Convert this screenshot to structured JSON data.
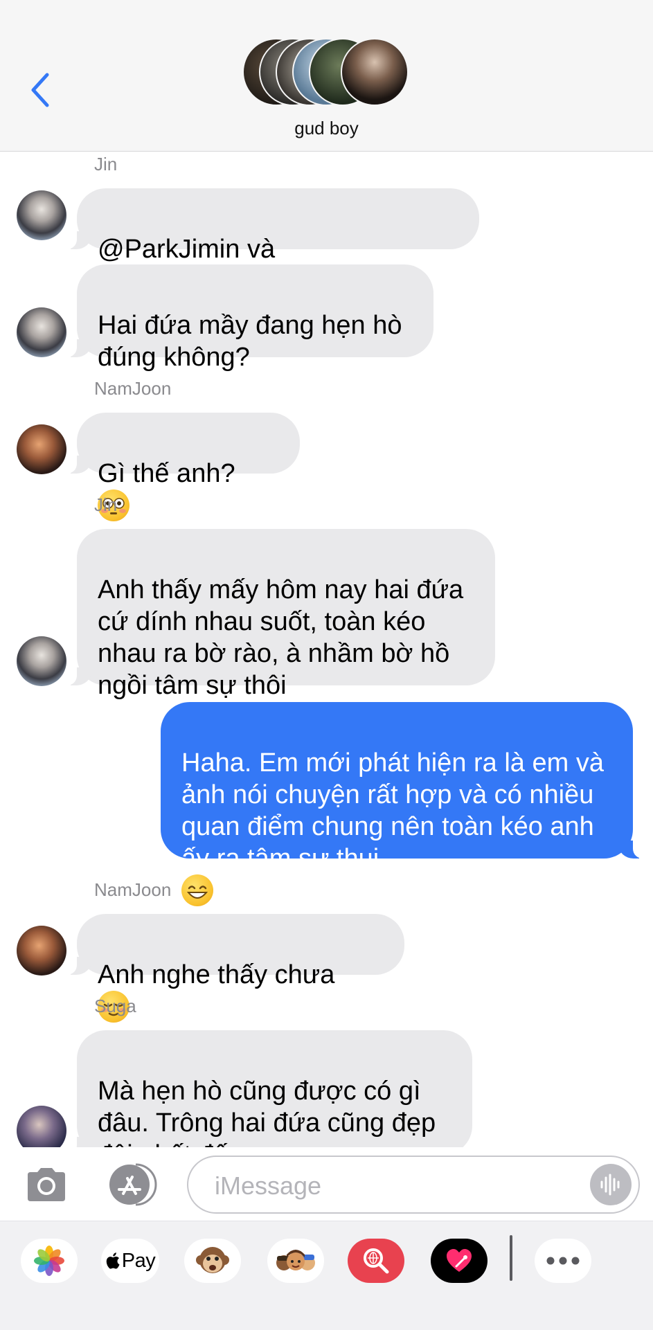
{
  "header": {
    "back_icon": "chevron-left-icon",
    "group_name": "gud boy",
    "member_avatars": [
      "member-avatar-1",
      "member-avatar-2",
      "member-avatar-3",
      "member-avatar-4",
      "member-avatar-5",
      "member-avatar-6"
    ]
  },
  "conversation": {
    "sender_jin_1": "Jin",
    "msg_jin_1": "@ParkJimin và @KimNamjoon",
    "msg_jin_2": "Hai đứa mầy đang hẹn hò\nđúng không?",
    "sender_namjoon_1": "NamJoon",
    "msg_namjoon_1": "Gì thế anh?",
    "sender_jin_2": "Jin",
    "msg_jin_3": "Anh thấy mấy hôm nay hai đứa\ncứ dính nhau suốt, toàn kéo\nnhau ra bờ rào, à nhầm bờ hồ\nngồi tâm sự thôi",
    "msg_me_1": "Haha. Em mới phát hiện ra là em và\nảnh nói chuyện rất hợp và có nhiều\nquan điểm chung nên toàn kéo anh\nấy ra tâm sự thui",
    "sender_namjoon_2": "NamJoon",
    "msg_namjoon_2": "Anh nghe thấy chưa",
    "sender_suga_1": "Suga",
    "msg_suga_1": "Mà hẹn hò cũng được có gì\nđâu. Trông hai đứa cũng đẹp\nđôi phết đấy"
  },
  "input_bar": {
    "camera_icon": "camera-icon",
    "apps_icon": "app-store-icon",
    "placeholder": "iMessage",
    "voice_icon": "audio-waveform-icon"
  },
  "app_drawer": {
    "photos": "photos-app-icon",
    "apple_pay_label": "Pay",
    "animoji": "animoji-monkey-icon",
    "memoji": "memoji-stickers-icon",
    "images_search": "images-search-icon",
    "digital_touch": "digital-touch-heart-icon",
    "more": "more-ellipsis-icon"
  },
  "colors": {
    "accent_blue": "#3478f6",
    "incoming_bubble": "#e9e9eb",
    "header_bg": "#f6f6f6",
    "drawer_bg": "#f1f1f3"
  }
}
